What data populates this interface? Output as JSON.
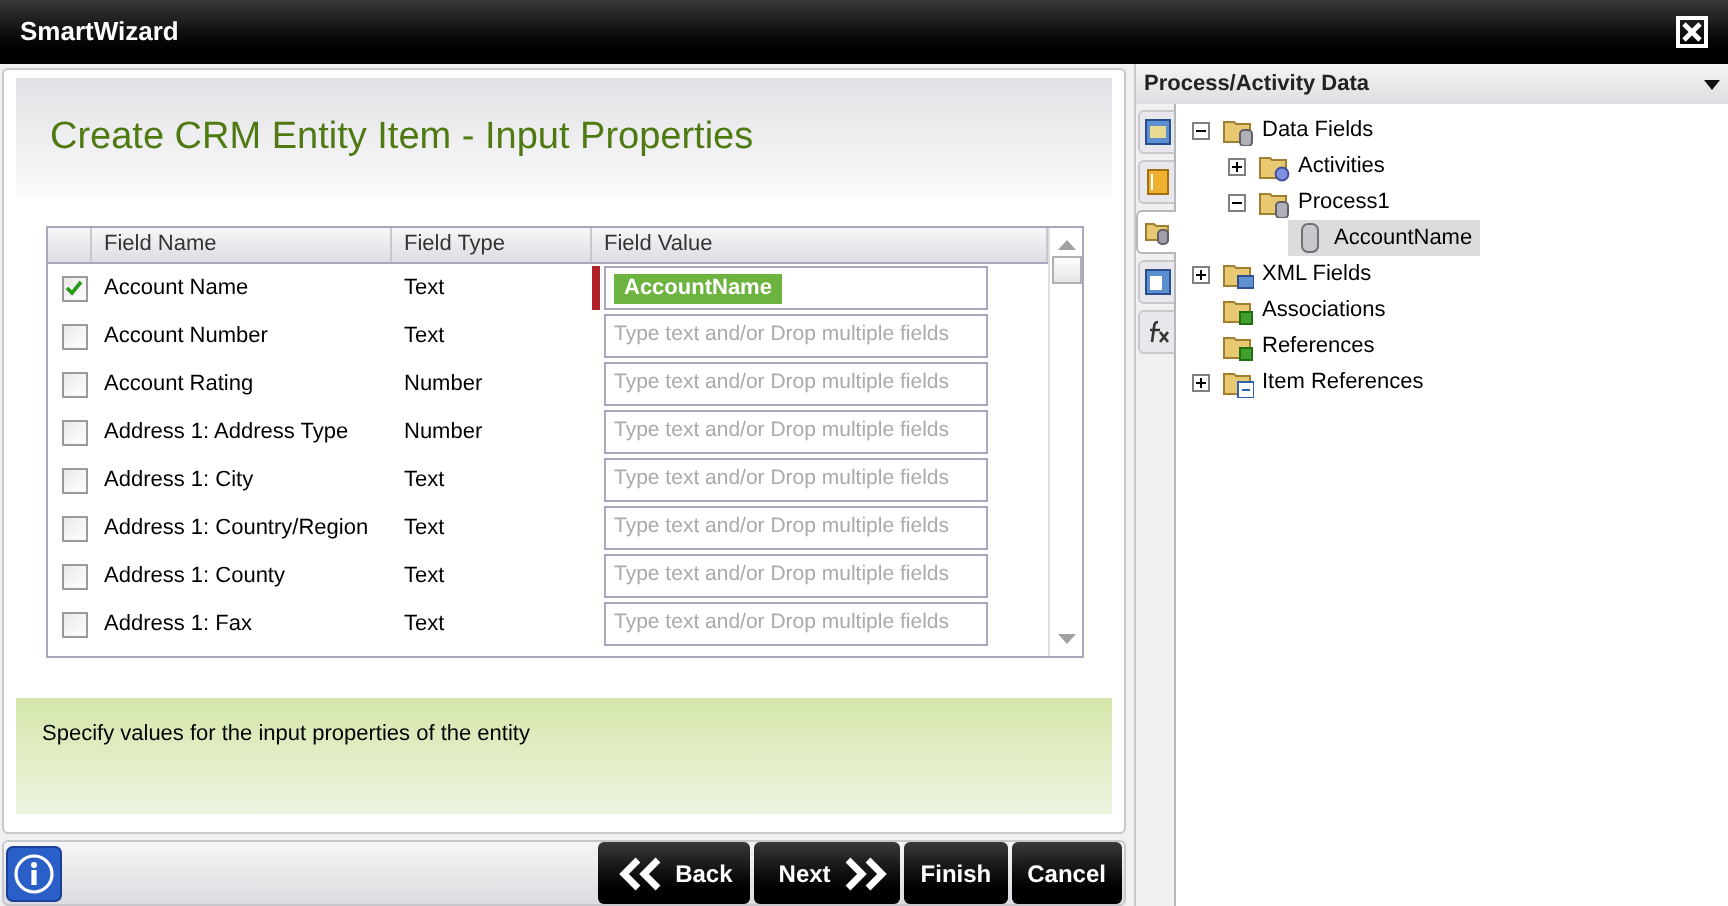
{
  "window": {
    "title": "SmartWizard"
  },
  "wizard": {
    "heading": "Create CRM Entity Item - Input Properties",
    "grid": {
      "columns": [
        "Field Name",
        "Field Type",
        "Field Value"
      ],
      "rows": [
        {
          "checked": true,
          "name": "Account Name",
          "type": "Text",
          "flagged": true,
          "value": "AccountName"
        },
        {
          "checked": false,
          "name": "Account Number",
          "type": "Text",
          "flagged": false,
          "placeholder": "Type text and/or Drop multiple fields"
        },
        {
          "checked": false,
          "name": "Account Rating",
          "type": "Number",
          "flagged": false,
          "placeholder": "Type text and/or Drop multiple fields"
        },
        {
          "checked": false,
          "name": "Address 1: Address Type",
          "type": "Number",
          "flagged": false,
          "placeholder": "Type text and/or Drop multiple fields"
        },
        {
          "checked": false,
          "name": "Address 1: City",
          "type": "Text",
          "flagged": false,
          "placeholder": "Type text and/or Drop multiple fields"
        },
        {
          "checked": false,
          "name": "Address 1: Country/Region",
          "type": "Text",
          "flagged": false,
          "placeholder": "Type text and/or Drop multiple fields"
        },
        {
          "checked": false,
          "name": "Address 1: County",
          "type": "Text",
          "flagged": false,
          "placeholder": "Type text and/or Drop multiple fields"
        },
        {
          "checked": false,
          "name": "Address 1: Fax",
          "type": "Text",
          "flagged": false,
          "placeholder": "Type text and/or Drop multiple fields"
        }
      ]
    },
    "description": "Specify values for the input properties of the entity",
    "buttons": [
      {
        "kind": "back",
        "label": "Back"
      },
      {
        "kind": "next",
        "label": "Next"
      },
      {
        "kind": "plain",
        "label": "Finish"
      },
      {
        "kind": "plain",
        "label": "Cancel"
      }
    ]
  },
  "side_panel": {
    "title": "Process/Activity Data",
    "side_tabs": [
      {
        "kind": "image",
        "selected": false
      },
      {
        "kind": "book",
        "selected": false
      },
      {
        "kind": "data",
        "selected": true
      },
      {
        "kind": "form",
        "selected": false
      },
      {
        "kind": "function",
        "selected": false
      }
    ],
    "tree": [
      {
        "kind": "data-folder",
        "label": "Data Fields",
        "expanded": true,
        "selected": false,
        "children": [
          {
            "kind": "gear-folder",
            "label": "Activities",
            "expanded": false,
            "selected": false
          },
          {
            "kind": "data-folder",
            "label": "Process1",
            "expanded": true,
            "selected": false,
            "children": [
              {
                "kind": "field",
                "label": "AccountName",
                "selected": true
              }
            ]
          }
        ]
      },
      {
        "kind": "xml-folder",
        "label": "XML Fields",
        "expanded": false,
        "selected": false
      },
      {
        "kind": "green-folder",
        "label": "Associations",
        "selected": false
      },
      {
        "kind": "green-folder",
        "label": "References",
        "selected": false
      },
      {
        "kind": "link-folder",
        "label": "Item References",
        "expanded": false,
        "selected": false
      }
    ]
  }
}
